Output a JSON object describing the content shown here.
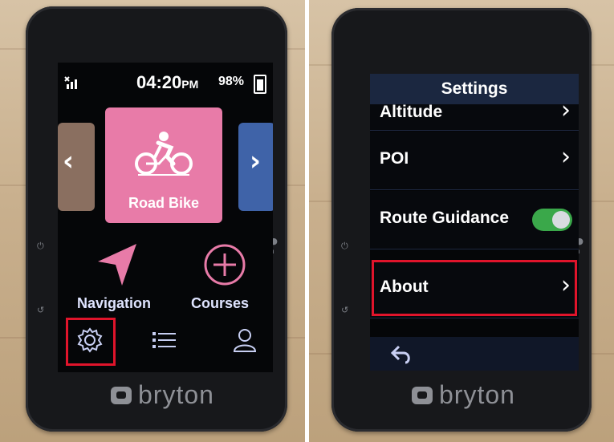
{
  "left_device": {
    "status": {
      "time": "04:20",
      "ampm": "PM",
      "battery": "98%"
    },
    "profile_card": {
      "label": "Road Bike"
    },
    "menu": {
      "navigation": "Navigation",
      "courses": "Courses"
    },
    "bottom_bar": {
      "settings_icon": "gear-icon",
      "list_icon": "list-icon",
      "profile_icon": "user-icon"
    },
    "brand": "bryton"
  },
  "right_device": {
    "title": "Settings",
    "items": [
      {
        "label": "Altitude"
      },
      {
        "label": "POI"
      },
      {
        "label": "Route Guidance",
        "toggle": "on"
      },
      {
        "label": "About"
      }
    ],
    "back_icon": "back-arrow-icon",
    "brand": "bryton"
  },
  "colors": {
    "accent_pink": "#e87ba8",
    "highlight_red": "#e0142b",
    "toggle_green": "#3aa84a"
  }
}
